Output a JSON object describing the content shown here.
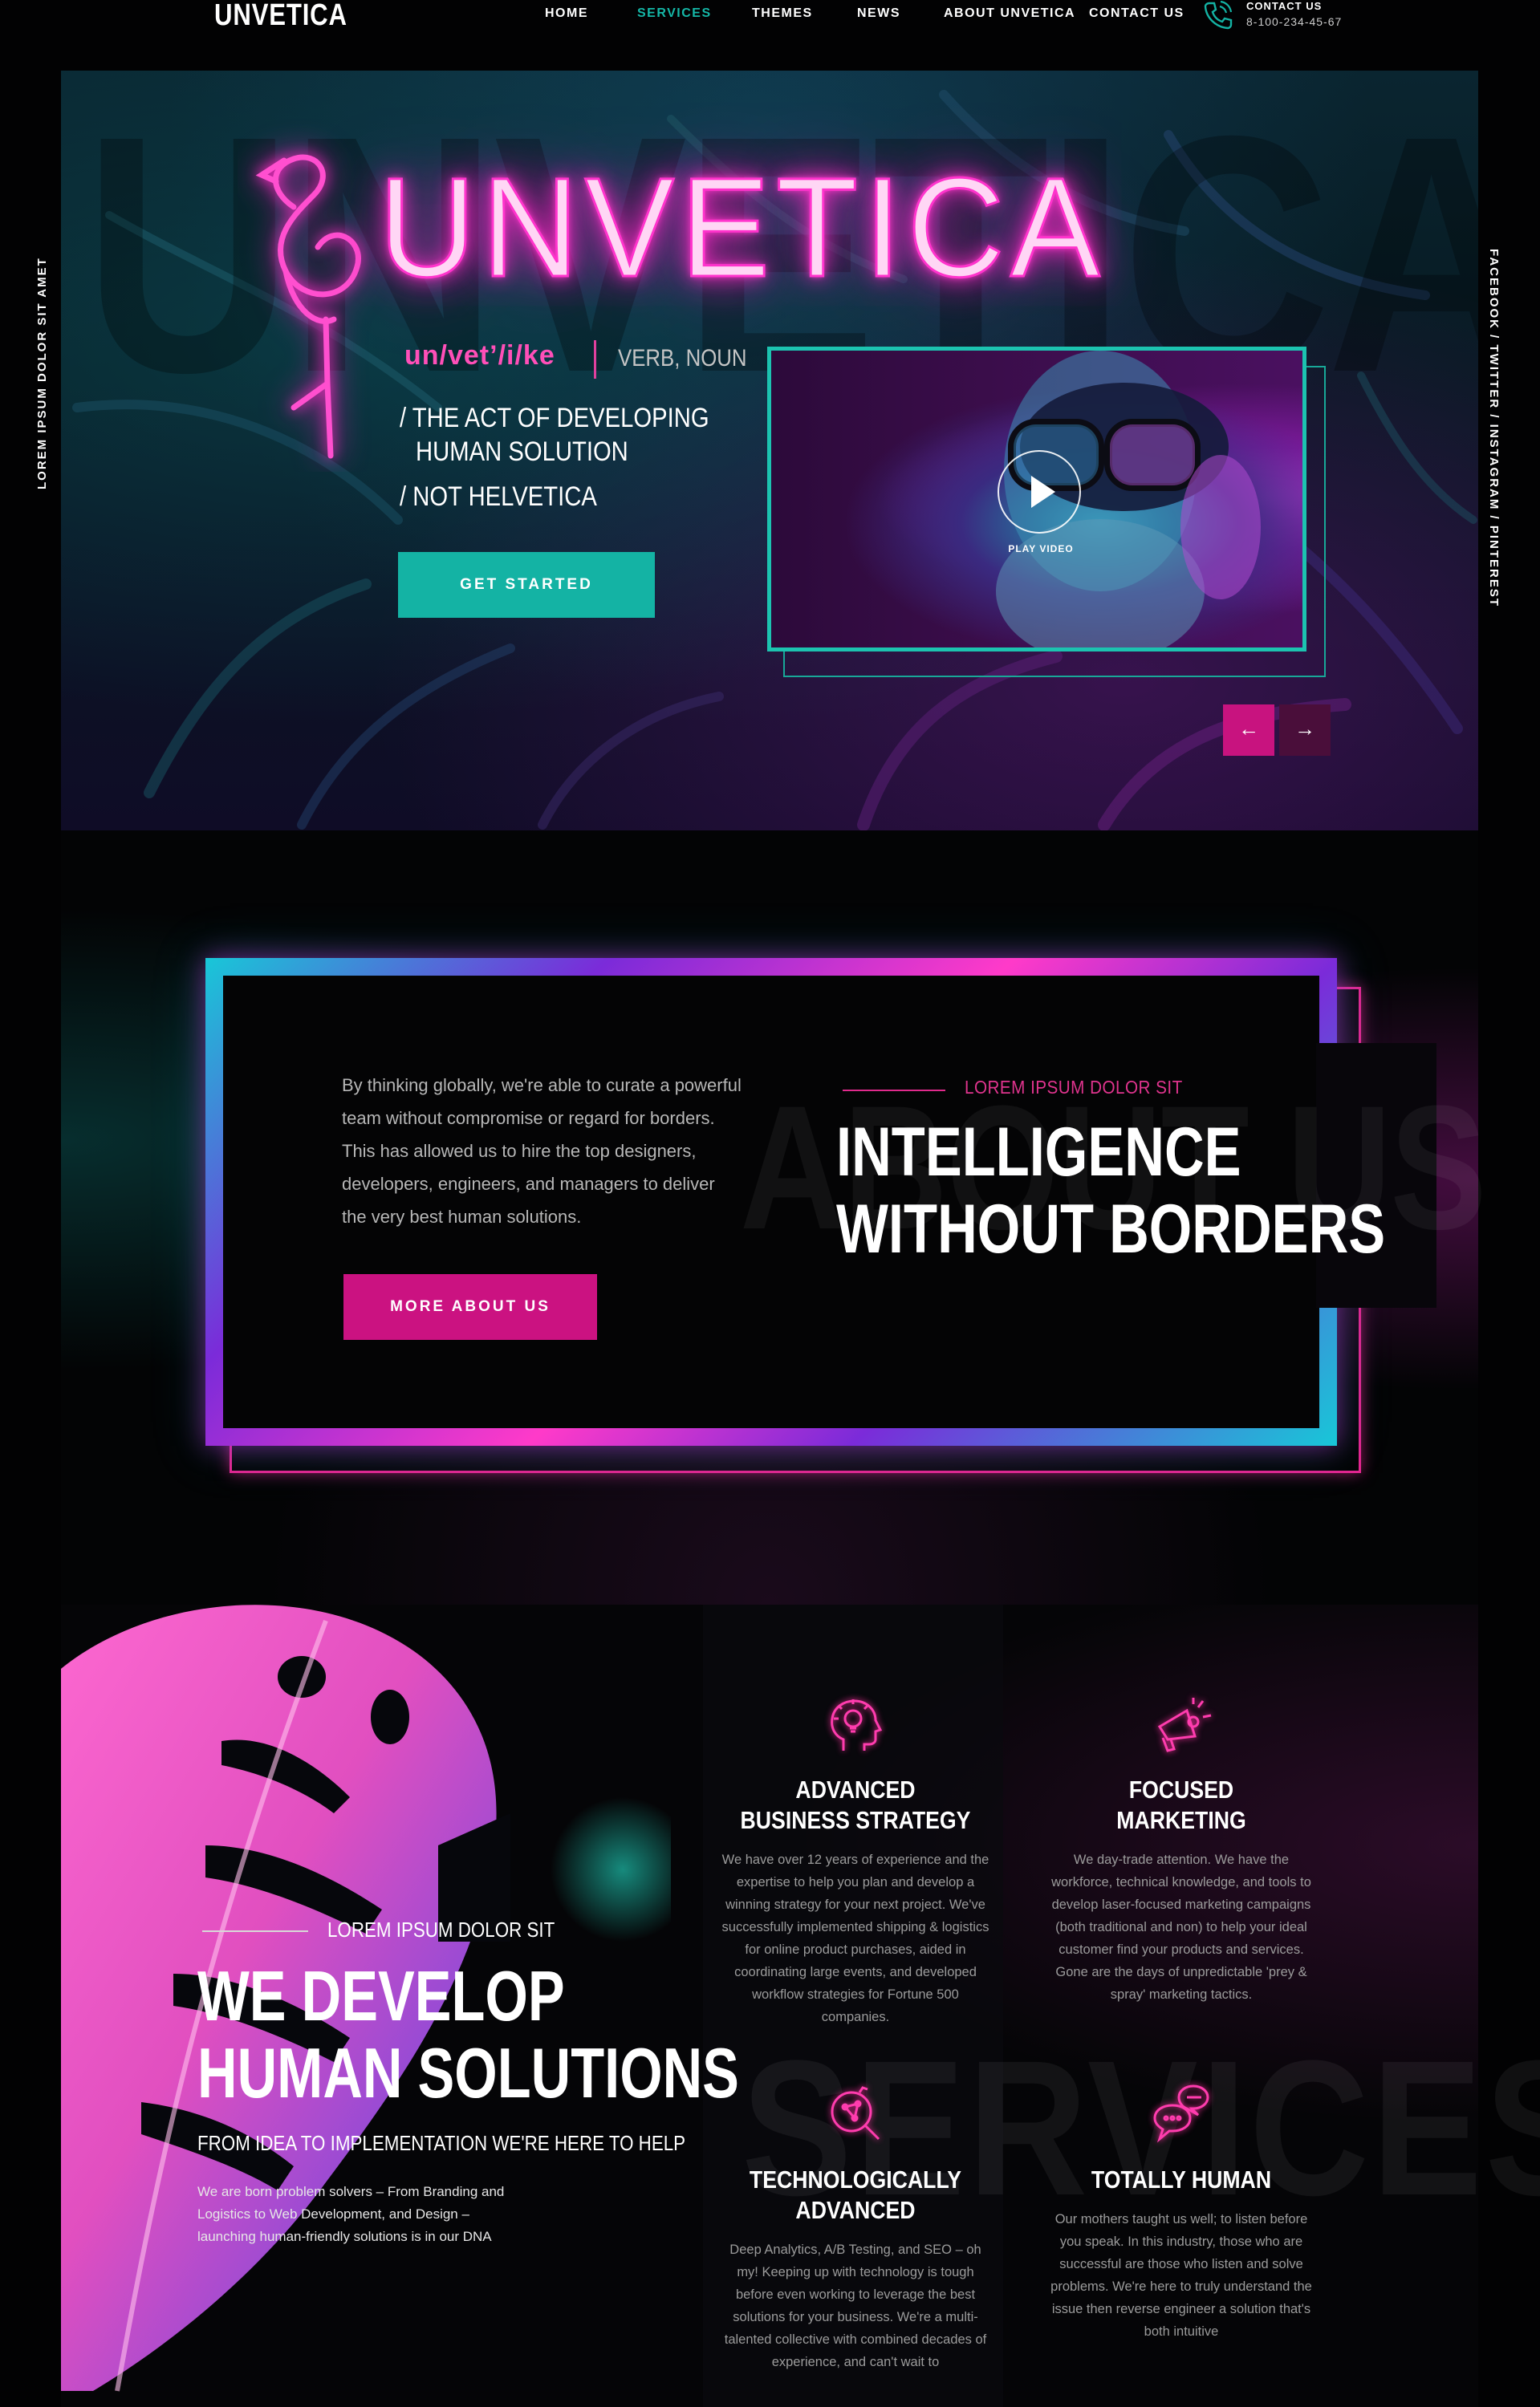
{
  "brand": {
    "logo": "UNVETICA"
  },
  "nav": {
    "items": [
      {
        "label": "HOME"
      },
      {
        "label": "SERVICES"
      },
      {
        "label": "THEMES"
      },
      {
        "label": "NEWS"
      },
      {
        "label": "ABOUT UNVETICA"
      },
      {
        "label": "CONTACT US"
      }
    ],
    "active_color": "#15b8a8"
  },
  "contact": {
    "label": "CONTACT US",
    "phone": "8-100-234-45-67"
  },
  "side": {
    "left_text": "LOREM IPSUM DOLOR SIT AMET",
    "right_text": "FACEBOOK / TWITTER / INSTAGRAM / PINTEREST"
  },
  "hero": {
    "bg_word": "UNVETICA",
    "neon_title": "UNVETICA",
    "pronunciation": "un/vet’/i/ke",
    "part_of_speech": "VERB, NOUN",
    "definition_1_line_1": "/ THE ACT OF DEVELOPING",
    "definition_1_line_2": "HUMAN SOLUTION",
    "definition_2": "/ NOT HELVETICA",
    "cta": "GET STARTED",
    "play_label": "PLAY VIDEO",
    "prev_icon": "arrow-left-icon",
    "next_icon": "arrow-right-icon"
  },
  "about": {
    "bg_word": "ABOUT US",
    "text": "By thinking globally, we're able to curate a powerful team without compromise or regard for borders. This has allowed us to hire the top designers, developers, engineers, and managers to deliver the very best human solutions.",
    "cta": "MORE ABOUT US",
    "eyebrow": "LOREM IPSUM DOLOR SIT",
    "title_line_1": "INTELLIGENCE",
    "title_line_2": "WITHOUT BORDERS"
  },
  "services": {
    "bg_word": "SERVICES",
    "eyebrow": "LOREM IPSUM DOLOR SIT",
    "title_line_1": "WE DEVELOP",
    "title_line_2": "HUMAN SOLUTIONS",
    "subtitle": "FROM IDEA TO IMPLEMENTATION  WE'RE HERE TO HELP",
    "description": "We are born problem solvers – From Branding and Logistics to Web Development, and Design – launching human-friendly solutions is in our DNA",
    "cards": [
      {
        "icon": "head-lightbulb-icon",
        "title": "ADVANCED BUSINESS STRATEGY",
        "text": "We have over 12 years of experience and the expertise to help you plan and develop a winning strategy for your next project. We've successfully implemented shipping & logistics for online product purchases, aided in coordinating large events, and developed workflow strategies for Fortune 500 companies."
      },
      {
        "icon": "megaphone-icon",
        "title": "FOCUSED MARKETING",
        "text": "We day-trade attention. We have the workforce, technical knowledge, and tools to develop laser-focused marketing campaigns (both traditional and non) to help your ideal customer find your products and services. Gone are the days of unpredictable 'prey & spray' marketing tactics."
      },
      {
        "icon": "magnifier-network-icon",
        "title": "TECHNOLOGICALLY ADVANCED",
        "text": "Deep Analytics, A/B Testing, and SEO – oh my! Keeping up with technology is tough before even working to leverage the best solutions for your business. We're a multi-talented collective with combined decades of experience, and can't wait to"
      },
      {
        "icon": "chat-bubbles-icon",
        "title": "TOTALLY HUMAN",
        "text": "Our mothers taught us well; to listen before you speak. In this industry, those who are successful are those who listen and solve problems. We're here to truly understand the issue then reverse engineer a solution that's both intuitive"
      }
    ]
  },
  "colors": {
    "teal": "#14b3a4",
    "magenta": "#cb1281",
    "neon_pink": "#ff33cc"
  }
}
